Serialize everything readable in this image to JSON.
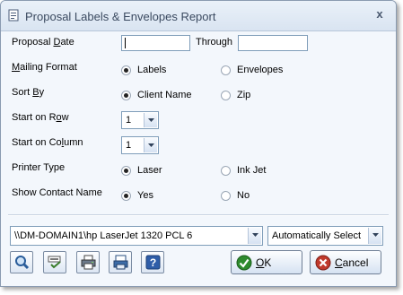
{
  "window": {
    "title": "Proposal Labels & Envelopes Report",
    "close_glyph": "x"
  },
  "form": {
    "proposal_date": {
      "label_pre": "Proposal ",
      "label_u": "D",
      "label_post": "ate",
      "value": "",
      "through_label": "Through",
      "through_value": ""
    },
    "mailing_format": {
      "label_pre": "",
      "label_u": "M",
      "label_post": "ailing Format",
      "options": [
        "Labels",
        "Envelopes"
      ],
      "selected": "Labels"
    },
    "sort_by": {
      "label_pre": "Sort ",
      "label_u": "B",
      "label_post": "y",
      "options": [
        "Client Name",
        "Zip"
      ],
      "selected": "Client Name"
    },
    "start_row": {
      "label_pre": "Start on R",
      "label_u": "o",
      "label_post": "w",
      "value": "1"
    },
    "start_column": {
      "label_pre": "Start on Co",
      "label_u": "l",
      "label_post": "umn",
      "value": "1"
    },
    "printer_type": {
      "label": "Printer Type",
      "options": [
        "Laser",
        "Ink Jet"
      ],
      "selected": "Laser"
    },
    "show_contact": {
      "label": "Show Contact Name",
      "options": [
        "Yes",
        "No"
      ],
      "selected": "Yes"
    }
  },
  "printer": {
    "name": "\\\\DM-DOMAIN1\\hp LaserJet 1320 PCL 6",
    "tray": "Automatically Select"
  },
  "buttons": {
    "ok_label": "OK",
    "ok_underline": "O",
    "ok_rest": "K",
    "cancel_label": "Cancel",
    "cancel_underline": "C",
    "cancel_rest": "ancel",
    "icons": [
      "search-icon",
      "spellcheck-icon",
      "print-preview-icon",
      "printer-setup-icon",
      "help-icon"
    ]
  },
  "colors": {
    "accent": "#3b4a60",
    "window_bg": "#f3f7fc",
    "ok_green": "#2e8b2e",
    "cancel_red": "#c0392b"
  }
}
